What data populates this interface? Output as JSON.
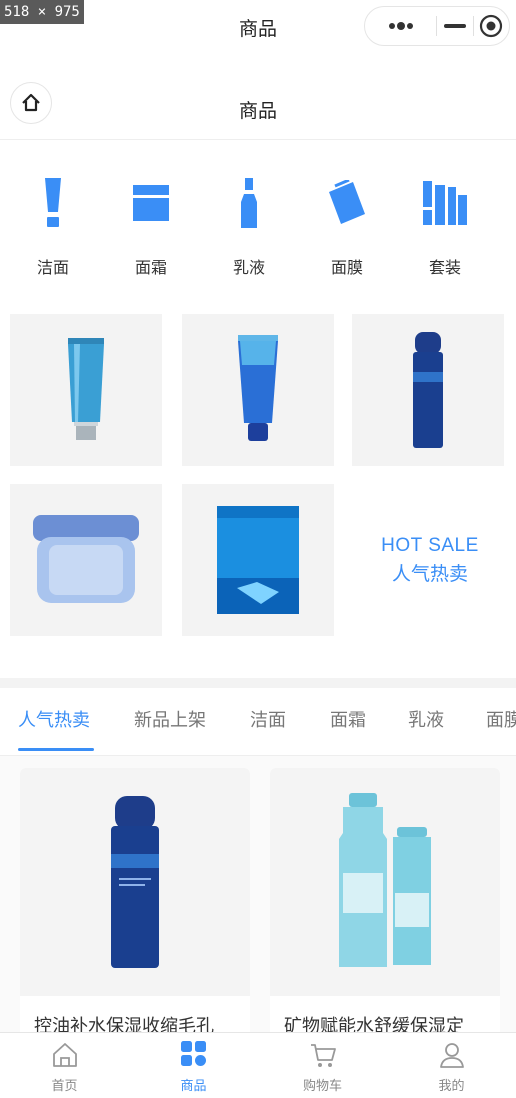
{
  "screenshot_label": "518 × 975",
  "navbar": {
    "title": "商品"
  },
  "header": {
    "title": "商品"
  },
  "categories": [
    {
      "label": "洁面",
      "icon": "cleanser-icon"
    },
    {
      "label": "面霜",
      "icon": "cream-icon"
    },
    {
      "label": "乳液",
      "icon": "lotion-icon"
    },
    {
      "label": "面膜",
      "icon": "mask-icon"
    },
    {
      "label": "套装",
      "icon": "set-icon"
    }
  ],
  "hot_sale": {
    "en": "HOT SALE",
    "cn": "人气热卖"
  },
  "tabs": [
    {
      "label": "人气热卖",
      "active": true
    },
    {
      "label": "新品上架",
      "active": false
    },
    {
      "label": "洁面",
      "active": false
    },
    {
      "label": "面霜",
      "active": false
    },
    {
      "label": "乳液",
      "active": false
    },
    {
      "label": "面膜",
      "active": false
    }
  ],
  "products": [
    {
      "title": "控油补水保湿收缩毛孔"
    },
    {
      "title": "矿物赋能水舒缓保湿定"
    }
  ],
  "tabbar": [
    {
      "label": "首页",
      "icon": "home-icon",
      "active": false
    },
    {
      "label": "商品",
      "icon": "grid-icon",
      "active": true
    },
    {
      "label": "购物车",
      "icon": "cart-icon",
      "active": false
    },
    {
      "label": "我的",
      "icon": "user-icon",
      "active": false
    }
  ],
  "colors": {
    "accent": "#3a8ef6",
    "tile_bg": "#f3f3f3",
    "product_navy": "#1a3f8f"
  }
}
